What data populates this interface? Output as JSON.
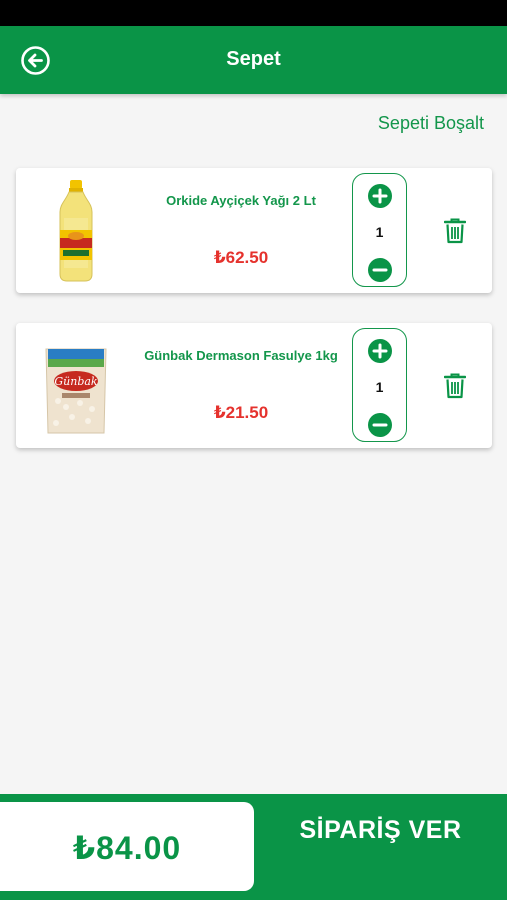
{
  "header": {
    "title": "Sepet",
    "back_icon": "arrow-left-circle-icon"
  },
  "clear_cart_label": "Sepeti Boşalt",
  "cart_items": [
    {
      "name": "Orkide Ayçiçek Yağı  2 Lt",
      "price": "₺62.50",
      "quantity": "1",
      "image": "sunflower-oil-bottle"
    },
    {
      "name": "Günbak Dermason Fasulye 1kg",
      "price": "₺21.50",
      "quantity": "1",
      "image": "bean-bag"
    }
  ],
  "footer": {
    "total": "₺84.00",
    "order_label": "SİPARİŞ VER"
  },
  "colors": {
    "brand_green": "#0a9447",
    "price_red": "#e5322d"
  }
}
